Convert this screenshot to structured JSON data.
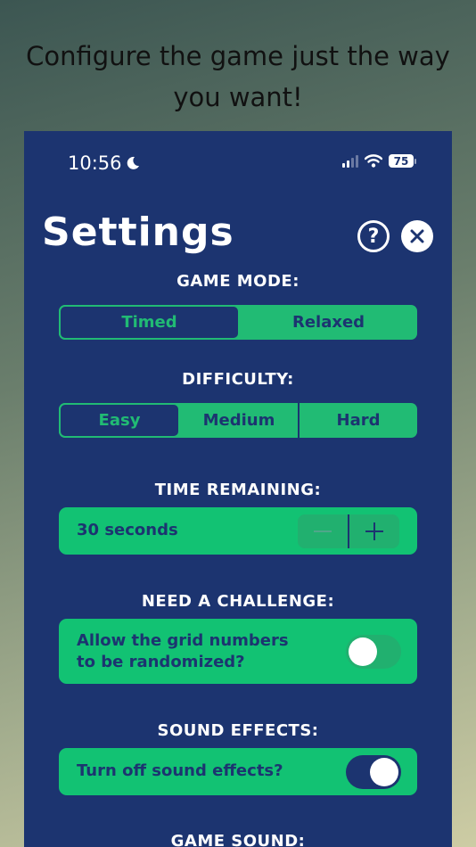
{
  "caption": {
    "line1": "Configure the game just the way",
    "line2": "you want!"
  },
  "status_bar": {
    "time": "10:56",
    "battery": "75"
  },
  "header": {
    "title": "Settings",
    "help_label": "?"
  },
  "game_mode": {
    "label": "GAME MODE:",
    "options": [
      "Timed",
      "Relaxed"
    ],
    "selected": "Timed"
  },
  "difficulty": {
    "label": "DIFFICULTY:",
    "options": [
      "Easy",
      "Medium",
      "Hard"
    ],
    "selected": "Easy"
  },
  "time_remaining": {
    "label": "TIME REMAINING:",
    "value": "30 seconds"
  },
  "challenge": {
    "label": "NEED A CHALLENGE:",
    "text_line1": "Allow the grid numbers",
    "text_line2": "to be randomized?",
    "enabled": false
  },
  "sound_effects": {
    "label": "SOUND EFFECTS:",
    "text": "Turn off sound effects?",
    "enabled": true
  },
  "game_sound": {
    "label": "GAME SOUND:"
  },
  "colors": {
    "background": "#1c3470",
    "accent": "#12c273",
    "text": "#ffffff"
  }
}
